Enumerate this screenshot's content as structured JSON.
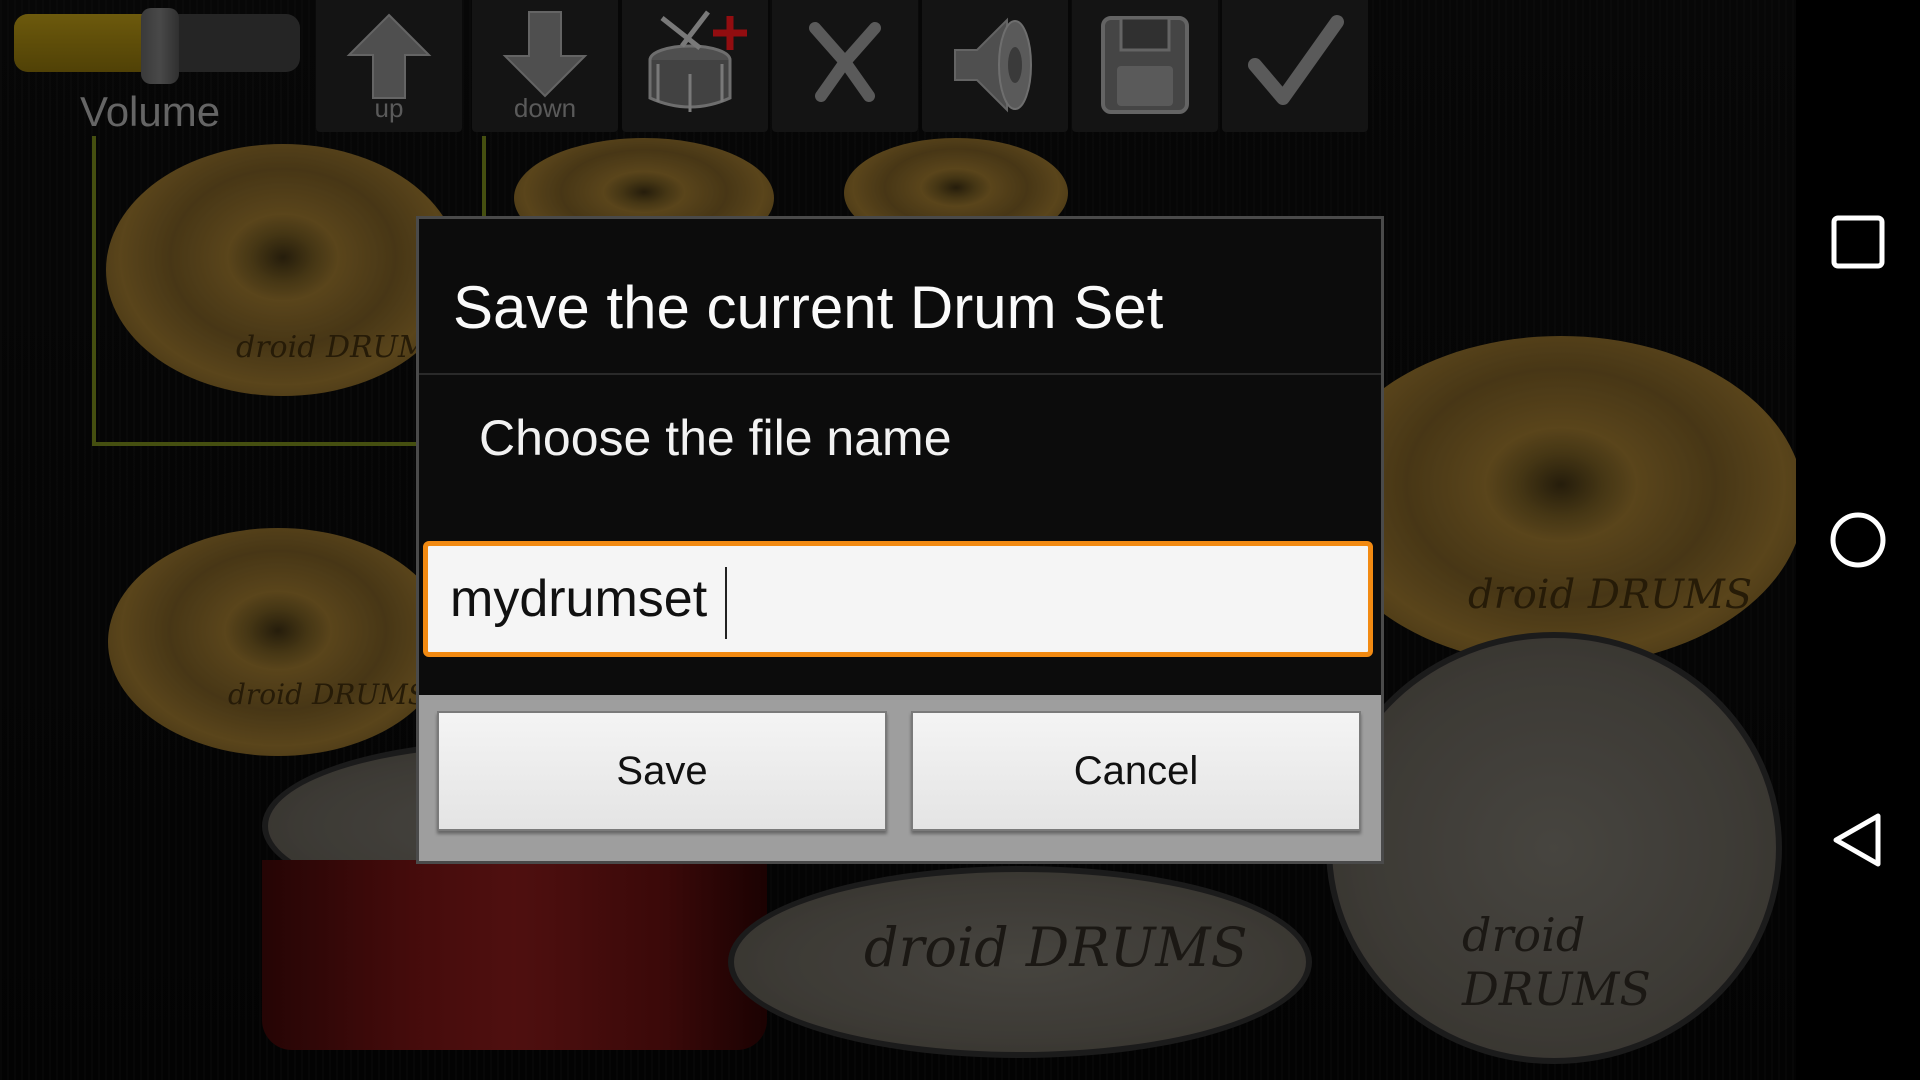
{
  "volume": {
    "label": "Volume",
    "level": 0.51
  },
  "toolbar": {
    "buttons": [
      {
        "name": "up",
        "caption": "up",
        "icon": "arrow-up-icon"
      },
      {
        "name": "down",
        "caption": "down",
        "icon": "arrow-down-icon"
      },
      {
        "name": "add-drum",
        "caption": "",
        "icon": "drum-add-icon"
      },
      {
        "name": "remove",
        "caption": "",
        "icon": "scissors-x-icon"
      },
      {
        "name": "sound",
        "caption": "",
        "icon": "speaker-icon"
      },
      {
        "name": "save",
        "caption": "",
        "icon": "floppy-disk-icon"
      },
      {
        "name": "confirm",
        "caption": "",
        "icon": "checkmark-icon"
      }
    ]
  },
  "drum_branding": "droid DRUMS",
  "dialog": {
    "title": "Save the current Drum Set",
    "message": "Choose the file name",
    "input_value": "mydrumset",
    "save_label": "Save",
    "cancel_label": "Cancel"
  },
  "navbar": {
    "recents_icon": "square-recents-icon",
    "home_icon": "circle-home-icon",
    "back_icon": "triangle-back-icon"
  },
  "colors": {
    "accent_orange": "#f28a12",
    "volume_gold": "#a78a14",
    "selector_green": "#6a7a1a"
  }
}
